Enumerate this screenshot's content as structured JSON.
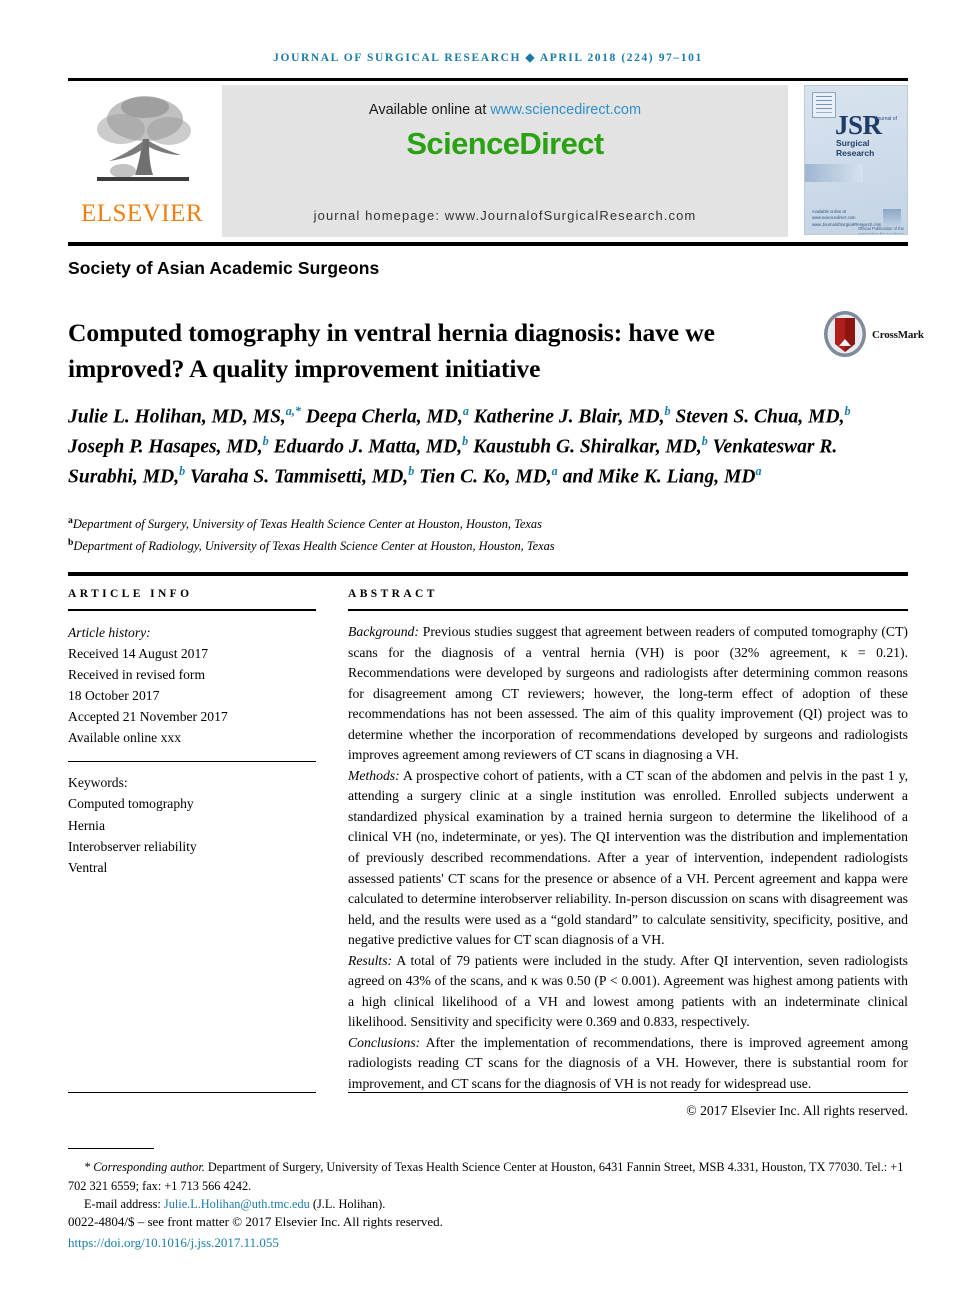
{
  "running_head": "Journal of Surgical Research ◆ April 2018 (224) 97–101",
  "masthead": {
    "publisher_name": "ELSEVIER",
    "publisher_logo_icon": "elsevier-tree-icon",
    "available_prefix": "Available online at",
    "available_link": "www.sciencedirect.com",
    "sciencedirect_logo": "ScienceDirect",
    "journal_homepage": "journal homepage: www.JournalofSurgicalResearch.com",
    "cover": {
      "elsevier_mark_icon": "elsevier-mark-icon",
      "acronym": "JSR",
      "acronym_sub": "Journal of",
      "title_line": "Surgical Research",
      "note": "Official Publication of the Association for Academic Surgery",
      "footer": "Available online at www.sciencedirect.com www.JournalofSurgicalResearch.com"
    }
  },
  "society": "Society of Asian Academic Surgeons",
  "title": "Computed tomography in ventral hernia diagnosis: have we improved? A quality improvement initiative",
  "crossmark": {
    "label": "CrossMark",
    "icon": "crossmark-badge-icon"
  },
  "authors_html": "Julie L. Holihan, MD, MS,<sup>a,*</sup> Deepa Cherla, MD,<sup>a</sup> Katherine J. Blair, MD,<sup>b</sup> Steven S. Chua, MD,<sup>b</sup> Joseph P. Hasapes, MD,<sup>b</sup> Eduardo J. Matta, MD,<sup>b</sup> Kaustubh G. Shiralkar, MD,<sup>b</sup> Venkateswar R. Surabhi, MD,<sup>b</sup> Varaha S. Tammisetti, MD,<sup>b</sup> Tien C. Ko, MD,<sup>a</sup> and Mike K. Liang, MD<sup>a</sup>",
  "affiliations": [
    {
      "marker": "a",
      "text": "Department of Surgery, University of Texas Health Science Center at Houston, Houston, Texas"
    },
    {
      "marker": "b",
      "text": "Department of Radiology, University of Texas Health Science Center at Houston, Houston, Texas"
    }
  ],
  "article_info": {
    "heading": "Article info",
    "history_label": "Article history:",
    "history": [
      "Received 14 August 2017",
      "Received in revised form",
      "18 October 2017",
      "Accepted 21 November 2017",
      "Available online xxx"
    ],
    "keywords_label": "Keywords:",
    "keywords": [
      "Computed tomography",
      "Hernia",
      "Interobserver reliability",
      "Ventral"
    ]
  },
  "abstract": {
    "heading": "Abstract",
    "sections": [
      {
        "label": "Background:",
        "text": " Previous studies suggest that agreement between readers of computed tomography (CT) scans for the diagnosis of a ventral hernia (VH) is poor (32% agreement, κ = 0.21). Recommendations were developed by surgeons and radiologists after determining common reasons for disagreement among CT reviewers; however, the long-term effect of adoption of these recommendations has not been assessed. The aim of this quality improvement (QI) project was to determine whether the incorporation of recommendations developed by surgeons and radiologists improves agreement among reviewers of CT scans in diagnosing a VH."
      },
      {
        "label": "Methods:",
        "text": " A prospective cohort of patients, with a CT scan of the abdomen and pelvis in the past 1 y, attending a surgery clinic at a single institution was enrolled. Enrolled subjects underwent a standardized physical examination by a trained hernia surgeon to determine the likelihood of a clinical VH (no, indeterminate, or yes). The QI intervention was the distribution and implementation of previously described recommendations. After a year of intervention, independent radiologists assessed patients' CT scans for the presence or absence of a VH. Percent agreement and kappa were calculated to determine interobserver reliability. In-person discussion on scans with disagreement was held, and the results were used as a “gold standard” to calculate sensitivity, specificity, positive, and negative predictive values for CT scan diagnosis of a VH."
      },
      {
        "label": "Results:",
        "text": " A total of 79 patients were included in the study. After QI intervention, seven radiologists agreed on 43% of the scans, and κ was 0.50 (P < 0.001). Agreement was highest among patients with a high clinical likelihood of a VH and lowest among patients with an indeterminate clinical likelihood. Sensitivity and specificity were 0.369 and 0.833, respectively."
      },
      {
        "label": "Conclusions:",
        "text": " After the implementation of recommendations, there is improved agreement among radiologists reading CT scans for the diagnosis of a VH. However, there is substantial room for improvement, and CT scans for the diagnosis of VH is not ready for widespread use."
      }
    ],
    "copyright": "© 2017 Elsevier Inc. All rights reserved."
  },
  "footnotes": {
    "corresponding_label": "* Corresponding author.",
    "corresponding_text": " Department of Surgery, University of Texas Health Science Center at Houston, 6431 Fannin Street, MSB 4.331, Houston, TX 77030. Tel.: +1 702 321 6559; fax: +1 713 566 4242.",
    "email_label": "E-mail address:",
    "email": "Julie.L.Holihan@uth.tmc.edu",
    "email_attribution": "(J.L. Holihan).",
    "imprint": "0022-4804/$ – see front matter © 2017 Elsevier Inc. All rights reserved.",
    "doi": "https://doi.org/10.1016/j.jss.2017.11.055"
  }
}
